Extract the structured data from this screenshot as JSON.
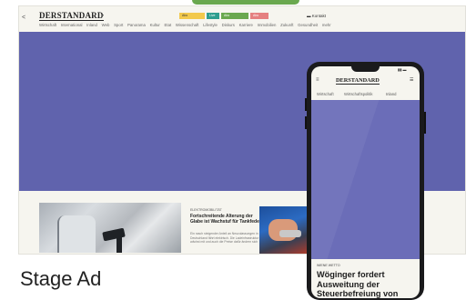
{
  "desktop": {
    "back_arrow": "<",
    "logo": "DERSTANDARD",
    "logo_arrow": "▾",
    "user_label": "Kontakt",
    "nav_items": [
      "Wirtschaft",
      "International",
      "Inland",
      "Web",
      "Sport",
      "Panorama",
      "Kultur",
      "Etat",
      "Wissenschaft",
      "Lifestyle",
      "Diskurs",
      "Karriere",
      "Immobilien",
      "Zukunft",
      "Gesundheit",
      "mehr"
    ],
    "badges": [
      {
        "label": "Abo",
        "color": "#f2c94c"
      },
      {
        "label": "Live",
        "color": "#2e9e8f"
      },
      {
        "label": "Abo",
        "color": "#6aa84f"
      },
      {
        "label": "Abo",
        "color": "#e58080"
      }
    ],
    "stage_color": "#6063ad",
    "article": {
      "kicker": "ELEKTROMOBILITÄT",
      "title": "Fortschreitende Alterung der Glabe ist Wachstuf für Tankfeder",
      "text": "Ein rasch steigender Anteil an Neuzulassungen in Deutschland fährt elektrisch. Die Ladeinfrastruktur wächst mit und auch die Preise dafür ändern sich"
    }
  },
  "caption": "Stage Ad",
  "phone": {
    "time": "15:09",
    "signal": "▮▮ ▬",
    "back": "≡",
    "logo": "DERSTANDARD",
    "account_icon": "☰",
    "tabs": [
      "Wirtschaft",
      "Wirtschaftspolitik",
      "Inland"
    ],
    "stage_color": "#6b6db8",
    "kicker": "WIENE WETTO",
    "title": "Wöginger fordert Ausweitung der Steuerbefreiung von"
  }
}
